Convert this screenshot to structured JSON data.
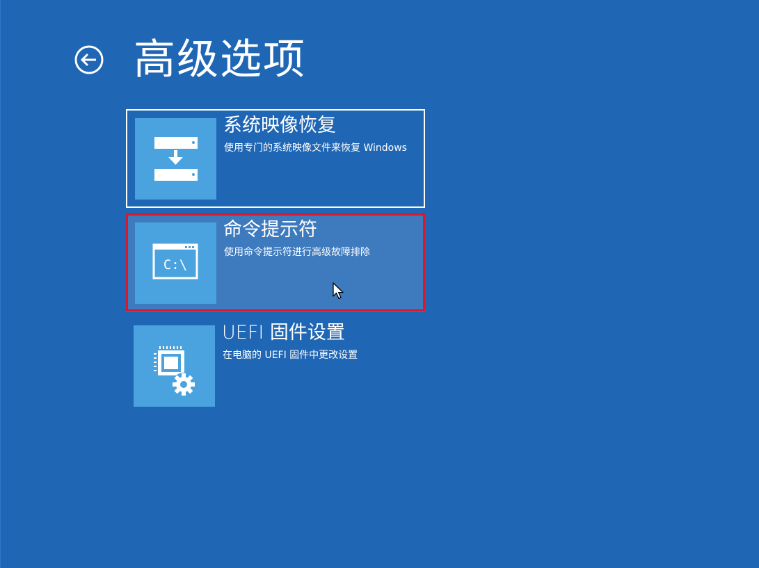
{
  "colors": {
    "background": "#1f66b4",
    "tile": "#4aa3de",
    "hover": "#3e7bbe",
    "highlight": "#d8182c"
  },
  "header": {
    "title": "高级选项",
    "back_icon": "back-arrow-circle-icon"
  },
  "options": [
    {
      "title": "系统映像恢复",
      "description": "使用专门的系统映像文件来恢复 Windows",
      "icon": "system-image-restore-icon"
    },
    {
      "title": "命令提示符",
      "description": "使用命令提示符进行高级故障排除",
      "icon": "command-prompt-icon",
      "icon_text": "C:\\"
    },
    {
      "title": "UEFI 固件设置",
      "description": "在电脑的 UEFI 固件中更改设置",
      "icon": "firmware-settings-icon"
    }
  ]
}
